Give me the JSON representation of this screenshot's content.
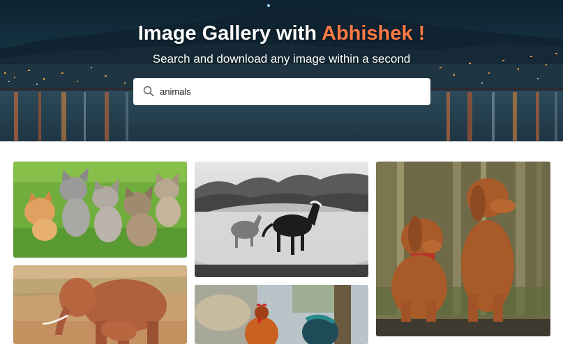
{
  "header": {
    "title_prefix": "Image Gallery with ",
    "title_accent": "Abhishek !",
    "subtitle": "Search and download any image within a second",
    "accent_color": "#ff7a45"
  },
  "search": {
    "value": "animals",
    "icon": "search-icon"
  },
  "gallery": {
    "images": [
      "kittens-photo",
      "elephants-photo",
      "horses-photo",
      "rooster-photo",
      "dogs-photo"
    ]
  }
}
